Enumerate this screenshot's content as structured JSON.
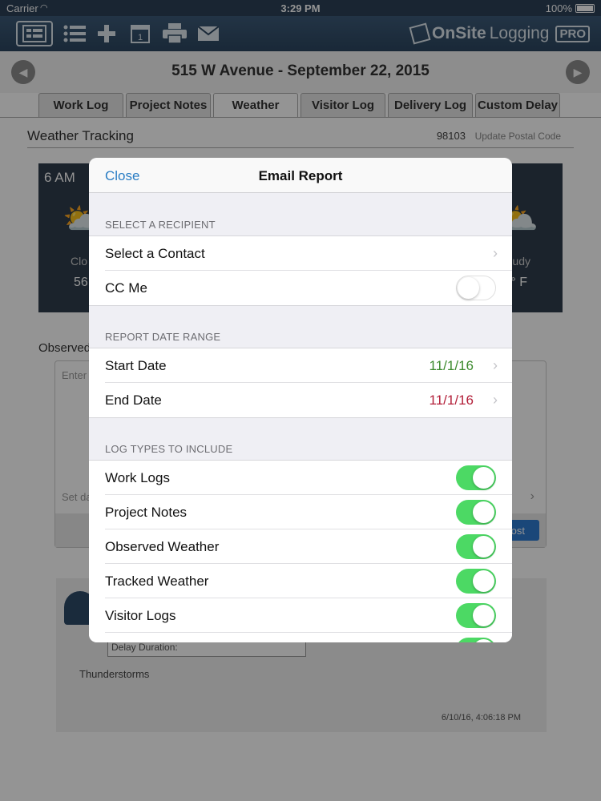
{
  "status_bar": {
    "carrier": "Carrier",
    "time": "3:29 PM",
    "battery": "100%"
  },
  "toolbar": {
    "brand": "OnSite",
    "brand_suffix": "Logging",
    "brand_badge": "PRO",
    "icons": [
      "list-view-icon",
      "bullet-list-icon",
      "add-icon",
      "calendar-icon",
      "print-icon",
      "email-icon"
    ],
    "calendar_day": "1"
  },
  "page": {
    "title": "515 W Avenue - September 22, 2015"
  },
  "tabs": [
    {
      "label": "Work Log"
    },
    {
      "label": "Project Notes"
    },
    {
      "label": "Weather"
    },
    {
      "label": "Visitor Log"
    },
    {
      "label": "Delivery Log"
    },
    {
      "label": "Custom Delay"
    }
  ],
  "background": {
    "section_title": "Weather Tracking",
    "postal_code": "98103",
    "update_postal": "Update Postal Code",
    "hour": "6 AM",
    "cond_left": "Clo",
    "temp_left": "56",
    "cond_right": "udy",
    "temp_right": "° F",
    "observed_label": "Observed",
    "observed_placeholder": "Enter",
    "set_date": "Set da",
    "post_label": "ost",
    "delay_field": "Delay Duration:",
    "note": "Thunderstorms",
    "timestamp": "6/10/16, 4:06:18 PM"
  },
  "modal": {
    "close": "Close",
    "title": "Email Report",
    "recipient_header": "SELECT A RECIPIENT",
    "select_contact": "Select a Contact",
    "cc_me": "CC Me",
    "cc_me_on": false,
    "date_header": "REPORT DATE RANGE",
    "start_label": "Start Date",
    "start_value": "11/1/16",
    "end_label": "End Date",
    "end_value": "11/1/16",
    "log_header": "LOG TYPES TO INCLUDE",
    "log_types": [
      {
        "label": "Work Logs",
        "on": true
      },
      {
        "label": "Project Notes",
        "on": true
      },
      {
        "label": "Observed Weather",
        "on": true
      },
      {
        "label": "Tracked Weather",
        "on": true
      },
      {
        "label": "Visitor Logs",
        "on": true
      }
    ]
  },
  "colors": {
    "accent": "#2a7dc4",
    "start_date": "#3e8b2f",
    "end_date": "#b3203a",
    "switch_on": "#4cd964",
    "toolbar": "#2c4660"
  }
}
